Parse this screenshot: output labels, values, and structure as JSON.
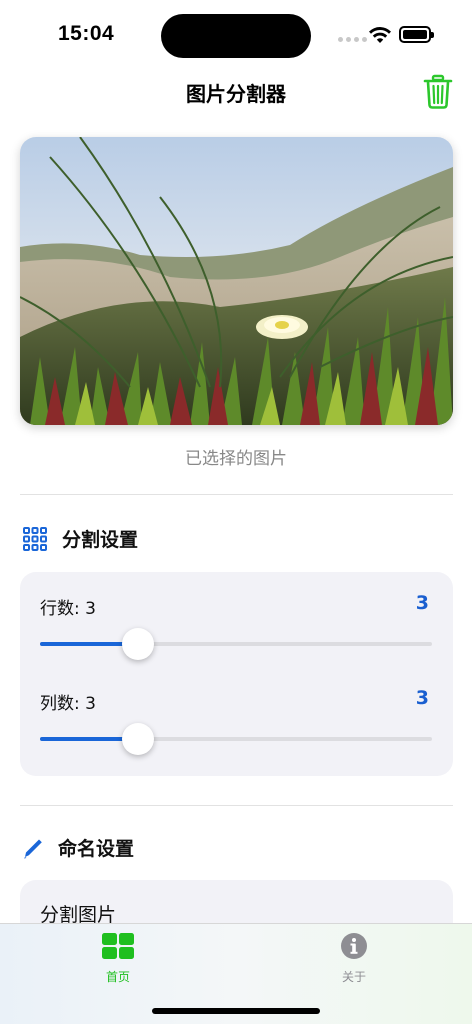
{
  "status_bar": {
    "time": "15:04"
  },
  "nav": {
    "title": "图片分割器",
    "trash_icon": "trash-icon"
  },
  "photo": {
    "caption": "已选择的图片"
  },
  "split_settings": {
    "title": "分割设置",
    "icon": "grid-icon",
    "rows": {
      "label": "行数: 3",
      "value": "3",
      "level": 0.25
    },
    "cols": {
      "label": "列数: 3",
      "value": "3",
      "level": 0.25
    }
  },
  "naming_settings": {
    "title": "命名设置",
    "icon": "pencil-icon",
    "field_label": "分割图片"
  },
  "tab_bar": {
    "home": {
      "label": "首页",
      "color": "#1fbf1f"
    },
    "about": {
      "label": "关于",
      "color": "#8e8e93"
    }
  },
  "colors": {
    "accent": "#1a66d8",
    "green": "#2cc72c"
  }
}
